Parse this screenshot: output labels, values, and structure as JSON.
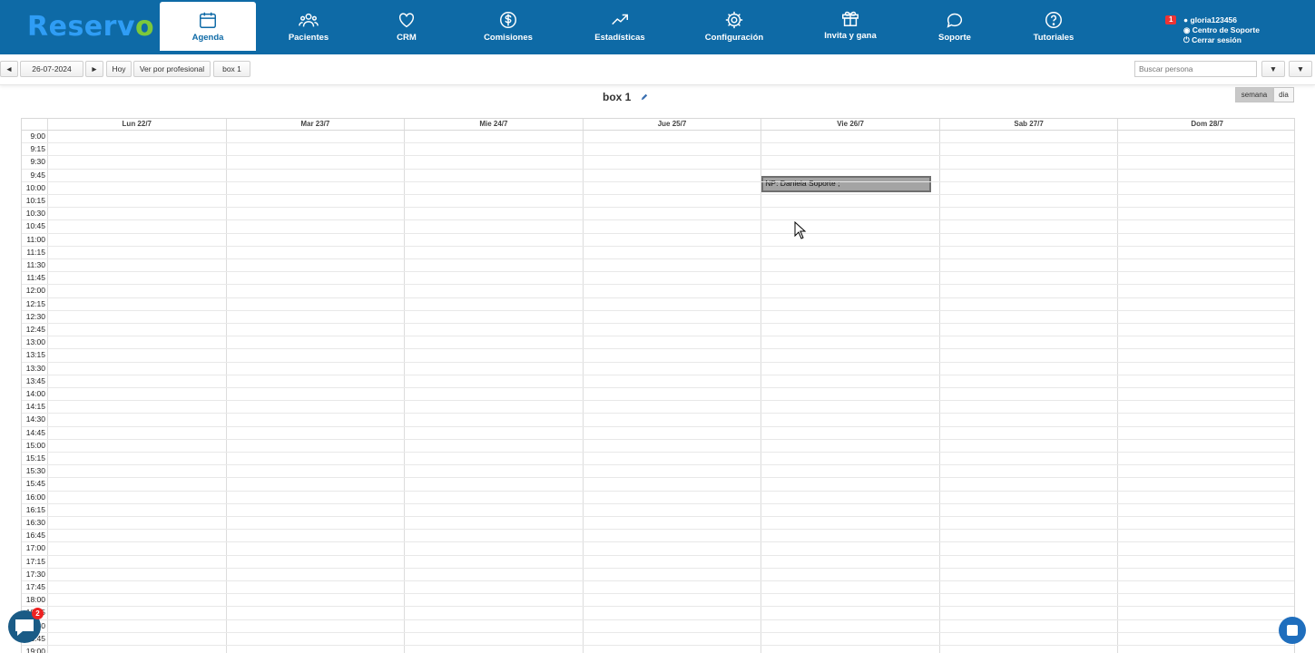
{
  "brand": {
    "name": "Reserv",
    "accent": "o"
  },
  "nav": [
    {
      "label": "Agenda",
      "icon": "calendar-icon"
    },
    {
      "label": "Pacientes",
      "icon": "users-icon"
    },
    {
      "label": "CRM",
      "icon": "heart-icon"
    },
    {
      "label": "Comisiones",
      "icon": "dollar-icon"
    },
    {
      "label": "Estadísticas",
      "icon": "trend-icon"
    },
    {
      "label": "Configuración",
      "icon": "gear-icon"
    },
    {
      "label": "Invita y gana",
      "icon": "gift-icon"
    },
    {
      "label": "Soporte",
      "icon": "chat-bubble-icon"
    },
    {
      "label": "Tutoriales",
      "icon": "help-icon"
    }
  ],
  "user": {
    "notifications": "1",
    "username": "gloria123456",
    "support_center": "Centro de Soporte",
    "logout": "Cerrar sesión"
  },
  "toolbar": {
    "prev": "◄",
    "date": "26-07-2024",
    "next": "►",
    "today": "Hoy",
    "view_by": "Ver por profesional",
    "box": "box 1",
    "search_placeholder": "Buscar persona"
  },
  "calendar": {
    "title": "box 1",
    "views": {
      "week": "semana",
      "day": "dia"
    },
    "days": [
      "Lun 22/7",
      "Mar 23/7",
      "Mie 24/7",
      "Jue 25/7",
      "Vie 26/7",
      "Sab 27/7",
      "Dom 28/7"
    ],
    "times": [
      "9:00",
      "9:15",
      "9:30",
      "9:45",
      "10:00",
      "10:15",
      "10:30",
      "10:45",
      "11:00",
      "11:15",
      "11:30",
      "11:45",
      "12:00",
      "12:15",
      "12:30",
      "12:45",
      "13:00",
      "13:15",
      "13:30",
      "13:45",
      "14:00",
      "14:15",
      "14:30",
      "14:45",
      "15:00",
      "15:15",
      "15:30",
      "15:45",
      "16:00",
      "16:15",
      "16:30",
      "16:45",
      "17:00",
      "17:15",
      "17:30",
      "17:45",
      "18:00",
      "18:15",
      "18:30",
      "18:45",
      "19:00"
    ],
    "event": {
      "text": "NP: Daniela Soporte ;",
      "day": "Vie 26/7",
      "time": "10:00"
    }
  },
  "chat_widget": {
    "badge": "2"
  },
  "colors": {
    "header": "#0e6aa6",
    "event": "#a4a4a4"
  }
}
